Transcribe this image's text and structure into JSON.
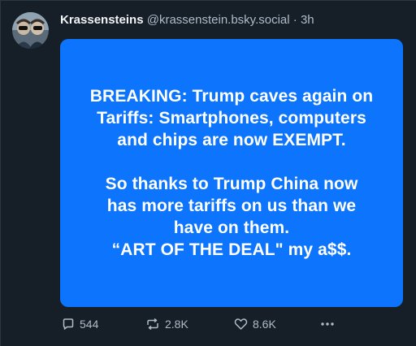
{
  "post": {
    "author": {
      "display_name": "Krassensteins",
      "handle": "@krassenstein.bsky.social",
      "separator": "·",
      "time": "3h",
      "avatar_icon": "twin-portrait-avatar"
    },
    "image": {
      "background": "#0d74fd",
      "lines": [
        "BREAKING: Trump caves again on",
        "Tariffs: Smartphones, computers",
        "and chips are now EXEMPT.",
        "So thanks to Trump China now",
        "has more tariffs on us than we",
        "have on them.",
        "“ART OF THE DEAL\" my a$$."
      ]
    },
    "actions": {
      "reply": {
        "icon": "reply-bubble-icon",
        "count": "544"
      },
      "repost": {
        "icon": "repost-icon",
        "count": "2.8K"
      },
      "like": {
        "icon": "heart-icon",
        "count": "8.6K"
      },
      "more": {
        "icon": "more-dots-icon"
      }
    }
  }
}
